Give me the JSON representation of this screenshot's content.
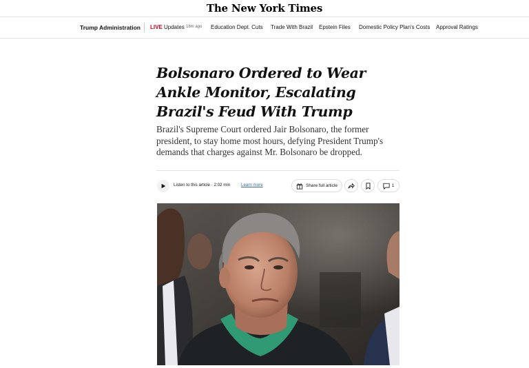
{
  "masthead": {
    "logo": "The New York Times"
  },
  "nav": {
    "section": "Trump Administration",
    "live_label": "LIVE",
    "updates_label": "Updates",
    "updates_ago": "18m ago",
    "links": [
      "Education Dept. Cuts",
      "Trade With Brazil",
      "Epstein Files",
      "Domestic Policy Plan's Costs",
      "Approval Ratings"
    ]
  },
  "article": {
    "headline": "Bolsonaro Ordered to Wear Ankle Monitor, Escalating Brazil's Feud With Trump",
    "summary": "Brazil's Supreme Court ordered Jair Bolsonaro, the former president, to stay home most hours, defying President Trump's demands that charges against Mr. Bolsonaro be dropped."
  },
  "toolbar": {
    "listen_label": "Listen to this article · 2:02 min",
    "learn_more": "Learn more",
    "share_full": "Share full article",
    "comment_count": "1"
  },
  "icons": {
    "play": "play-icon",
    "gift": "gift-icon",
    "share": "share-arrow-icon",
    "bookmark": "bookmark-icon",
    "comment": "comment-icon"
  }
}
